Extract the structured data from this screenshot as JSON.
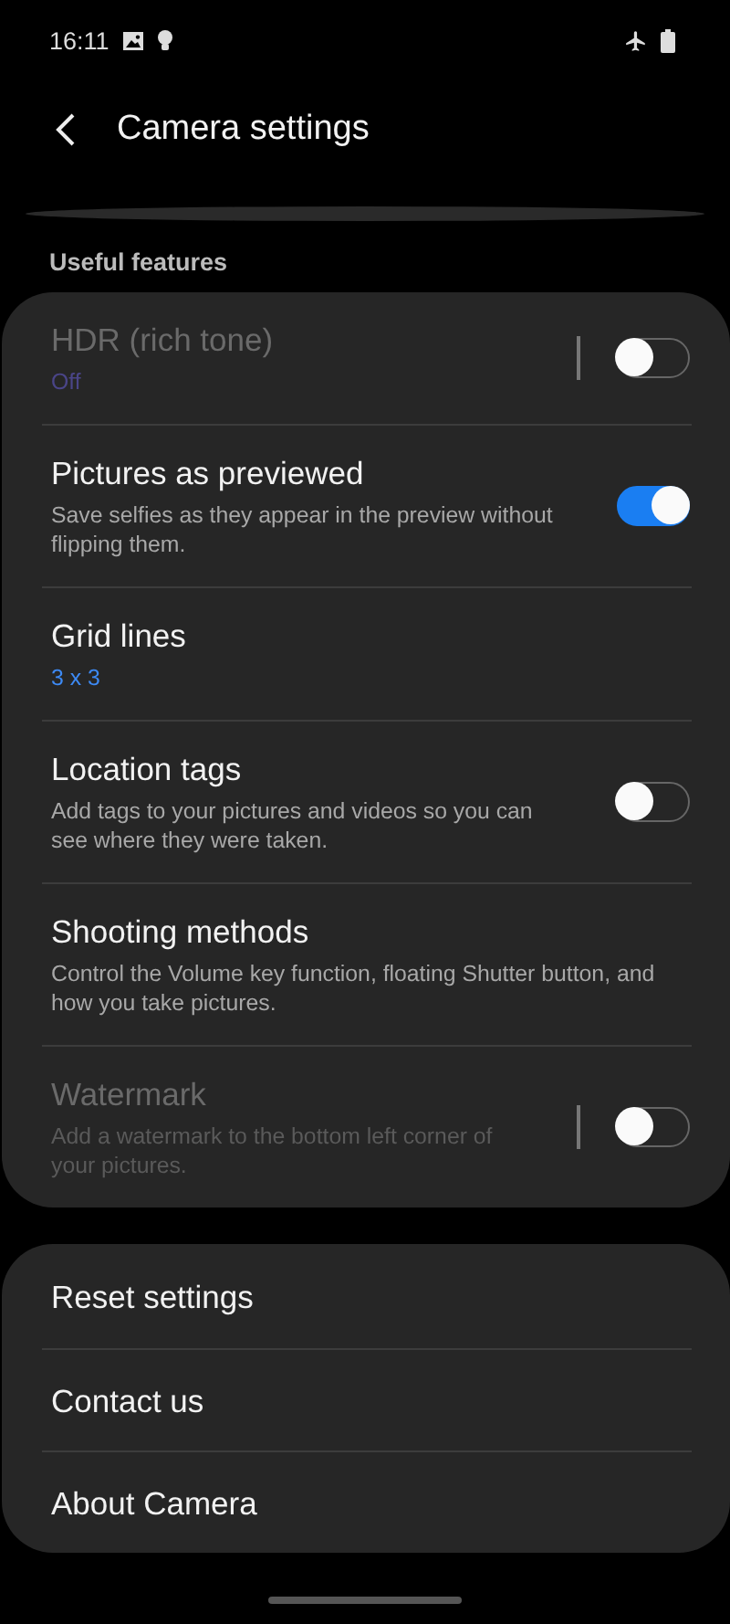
{
  "status_bar": {
    "time": "16:11"
  },
  "header": {
    "title": "Camera settings"
  },
  "section": {
    "title": "Useful features"
  },
  "features": [
    {
      "kind": "switch",
      "title": "HDR (rich tone)",
      "summary": "Off",
      "summary_accent": true,
      "disabled": true,
      "separator": true,
      "on": false
    },
    {
      "kind": "switch",
      "title": "Pictures as previewed",
      "summary": "Save selfies as they appear in the preview without flipping them.",
      "summary_accent": false,
      "disabled": false,
      "separator": false,
      "on": true
    },
    {
      "kind": "link",
      "title": "Grid lines",
      "summary": "3 x 3",
      "summary_accent": true,
      "disabled": false
    },
    {
      "kind": "switch",
      "title": "Location tags",
      "summary": "Add tags to your pictures and videos so you can see where they were taken.",
      "summary_accent": false,
      "disabled": false,
      "separator": false,
      "on": false
    },
    {
      "kind": "link",
      "title": "Shooting methods",
      "summary": "Control the Volume key function, floating Shutter button, and how you take pictures.",
      "summary_accent": false,
      "disabled": false
    },
    {
      "kind": "switch",
      "title": "Watermark",
      "summary": "Add a watermark to the bottom left corner of your pictures.",
      "summary_accent": false,
      "disabled": true,
      "separator": true,
      "on": false
    }
  ],
  "more": [
    {
      "title": "Reset settings"
    },
    {
      "title": "Contact us"
    },
    {
      "title": "About Camera"
    }
  ]
}
